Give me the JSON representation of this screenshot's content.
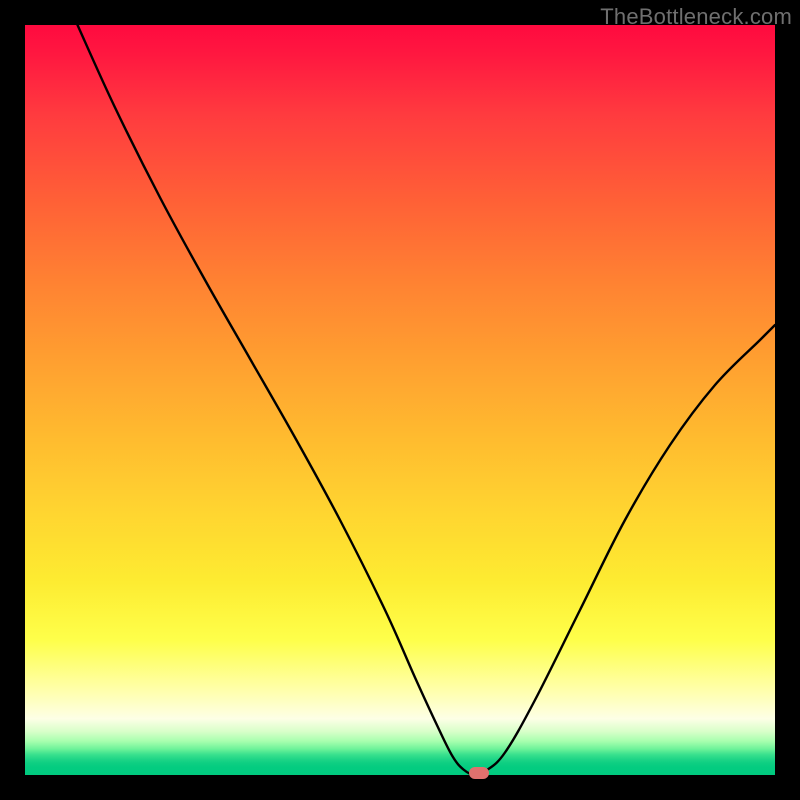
{
  "watermark": "TheBottleneck.com",
  "colors": {
    "frame": "#000000",
    "curve": "#000000",
    "marker": "#e0716e",
    "watermark": "#6f6f6f"
  },
  "chart_data": {
    "type": "line",
    "title": "",
    "xlabel": "",
    "ylabel": "",
    "xlim": [
      0,
      100
    ],
    "ylim": [
      0,
      100
    ],
    "background_gradient": {
      "orientation": "vertical",
      "stops": [
        {
          "pos": 0,
          "color": "#ff0a3f"
        },
        {
          "pos": 50,
          "color": "#ffbb2f"
        },
        {
          "pos": 82,
          "color": "#feff4a"
        },
        {
          "pos": 92.5,
          "color": "#fdffe6"
        },
        {
          "pos": 100,
          "color": "#00ca7f"
        }
      ]
    },
    "series": [
      {
        "name": "bottleneck-curve",
        "x": [
          7,
          12,
          18,
          24,
          30,
          36,
          42,
          48,
          52,
          55,
          57,
          58.5,
          60,
          61.5,
          64,
          68,
          74,
          80,
          86,
          92,
          98,
          100
        ],
        "y": [
          100,
          89,
          77,
          66,
          55.5,
          45,
          34,
          22,
          13,
          6.5,
          2.5,
          0.7,
          0,
          0.6,
          3,
          10,
          22,
          34,
          44,
          52,
          58,
          60
        ]
      }
    ],
    "marker": {
      "x": 60.5,
      "y": 0
    },
    "grid": false,
    "legend": false
  }
}
